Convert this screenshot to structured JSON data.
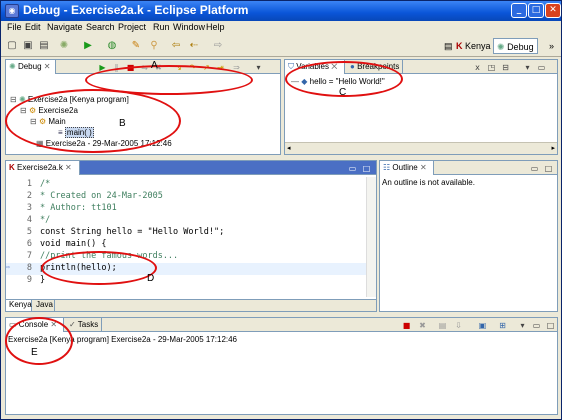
{
  "window": {
    "title": "Debug - Exercise2a.k - Eclipse Platform"
  },
  "menu": [
    "File",
    "Edit",
    "Navigate",
    "Search",
    "Project",
    "Run",
    "Window",
    "Help"
  ],
  "perspectives": {
    "kenya": "Kenya",
    "debug": "Debug"
  },
  "debug_view": {
    "tab": "Debug",
    "tree": [
      "Exercise2a [Kenya program]",
      "Exercise2a",
      "Main",
      "main( )",
      "Exercise2a - 29-Mar-2005 17:12:46"
    ]
  },
  "variables_view": {
    "tabs": [
      "Variables",
      "Breakpoints"
    ],
    "row": "hello = \"Hello World!\""
  },
  "editor": {
    "tab": "Exercise2a.k",
    "lines": [
      {
        "n": "1",
        "text": "/*"
      },
      {
        "n": "2",
        "text": " * Created on 24-Mar-2005"
      },
      {
        "n": "3",
        "text": " * Author: tt101"
      },
      {
        "n": "4",
        "text": " */"
      },
      {
        "n": "5",
        "text": "const String hello = \"Hello World!\";"
      },
      {
        "n": "6",
        "text": "void main() {"
      },
      {
        "n": "7",
        "text": "   //print the famous words..."
      },
      {
        "n": "8",
        "text": "   println(hello);"
      },
      {
        "n": "9",
        "text": "}"
      }
    ],
    "bottom_tabs": [
      "Kenya",
      "Java"
    ]
  },
  "outline_view": {
    "tab": "Outline",
    "message": "An outline is not available."
  },
  "console_view": {
    "tabs": [
      "Console",
      "Tasks"
    ],
    "text": "Exercise2a [Kenya program] Exercise2a - 29-Mar-2005 17:12:46"
  },
  "annotations": [
    "A",
    "B",
    "C",
    "D",
    "E"
  ]
}
